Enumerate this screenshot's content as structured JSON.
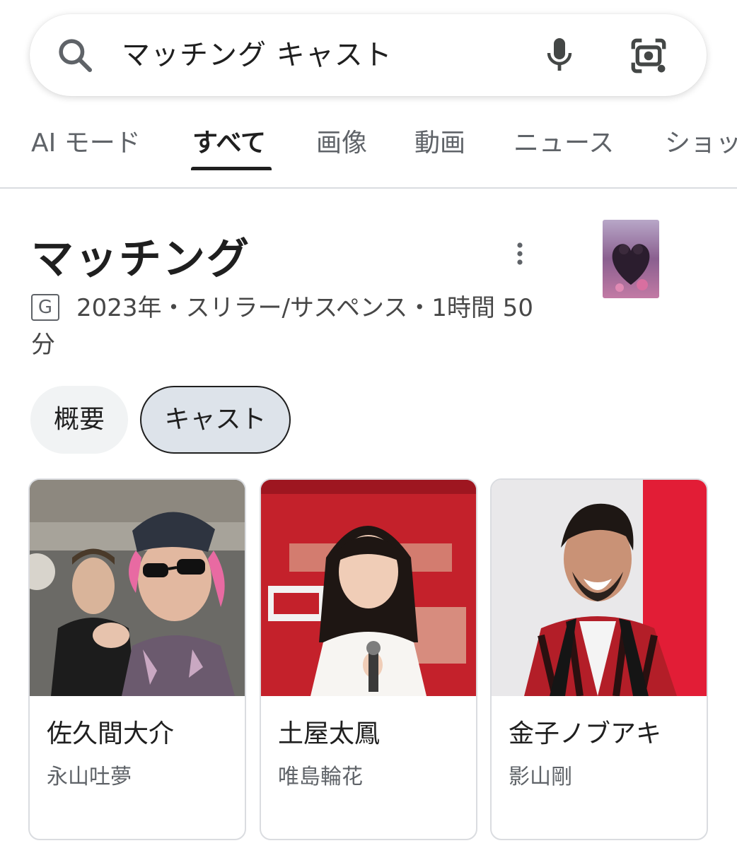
{
  "search": {
    "query": "マッチング キャスト",
    "search_icon": "search-icon",
    "voice_icon": "microphone-icon",
    "lens_icon": "camera-lens-icon"
  },
  "tabs": [
    {
      "label": "AI モード",
      "active": false
    },
    {
      "label": "すべて",
      "active": true
    },
    {
      "label": "画像",
      "active": false
    },
    {
      "label": "動画",
      "active": false
    },
    {
      "label": "ニュース",
      "active": false
    },
    {
      "label": "ショッ",
      "active": false
    }
  ],
  "knowledge_panel": {
    "title": "マッチング",
    "rating": "G",
    "meta": "2023年・スリラー/サスペンス・1時間 50分",
    "more_icon": "more-vert-icon",
    "chips": [
      {
        "label": "概要",
        "selected": false
      },
      {
        "label": "キャスト",
        "selected": true
      }
    ]
  },
  "cast": [
    {
      "actor": "佐久間大介",
      "role": "永山吐夢"
    },
    {
      "actor": "土屋太鳳",
      "role": "唯島輪花"
    },
    {
      "actor": "金子ノブアキ",
      "role": "影山剛"
    }
  ]
}
